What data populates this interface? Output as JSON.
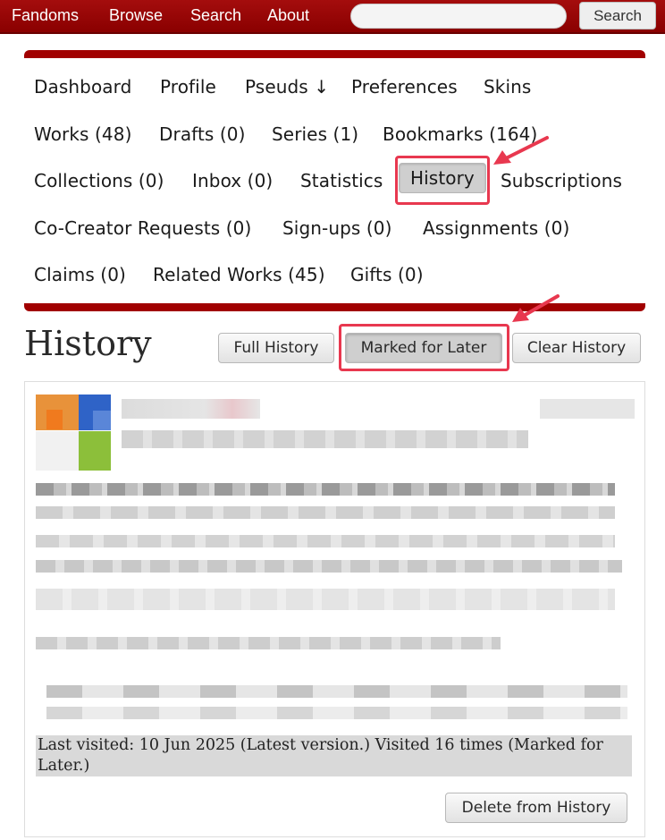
{
  "topnav": {
    "links": [
      "Fandoms",
      "Browse",
      "Search",
      "About"
    ],
    "search_placeholder": "",
    "search_button": "Search"
  },
  "menu": {
    "items": [
      "Dashboard",
      "Profile",
      "Pseuds ↓",
      "Preferences",
      "Skins",
      "Works (48)",
      "Drafts (0)",
      "Series (1)",
      "Bookmarks (164)",
      "Collections (0)",
      "Inbox (0)",
      "Statistics",
      "History",
      "Subscriptions",
      "Co-Creator Requests (0)",
      "Sign-ups (0)",
      "Assignments (0)",
      "Claims (0)",
      "Related Works (45)",
      "Gifts (0)"
    ],
    "current": "History"
  },
  "page": {
    "title": "History",
    "buttons": [
      "Full History",
      "Marked for Later",
      "Clear History"
    ],
    "active_button": "Marked for Later"
  },
  "blurb": {
    "last_visited_line1": "Last visited: 10 Jun 2025 (Latest version.) Visited 16 times (Marked for",
    "last_visited_line2": "Later.)",
    "delete_button": "Delete from History"
  },
  "colors": {
    "header_red": "#990000",
    "highlight": "#e8384f"
  }
}
